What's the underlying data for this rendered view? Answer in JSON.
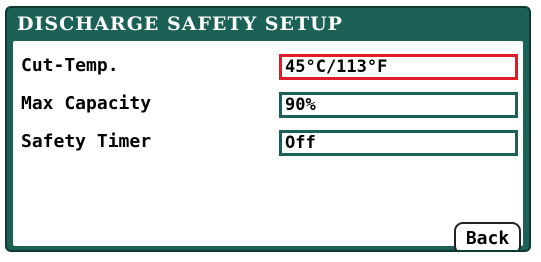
{
  "screen": {
    "title": "DISCHARGE SAFETY SETUP"
  },
  "settings": [
    {
      "label": "Cut-Temp.",
      "value": "45°C/113°F",
      "selected": true
    },
    {
      "label": "Max Capacity",
      "value": "90%",
      "selected": false
    },
    {
      "label": "Safety Timer",
      "value": "Off",
      "selected": false
    }
  ],
  "back_button": {
    "label": "Back"
  },
  "colors": {
    "header_bg": "#1c6155",
    "field_border": "#1c6155",
    "selected_border": "#e01e2a",
    "panel_bg": "#ffffff"
  }
}
